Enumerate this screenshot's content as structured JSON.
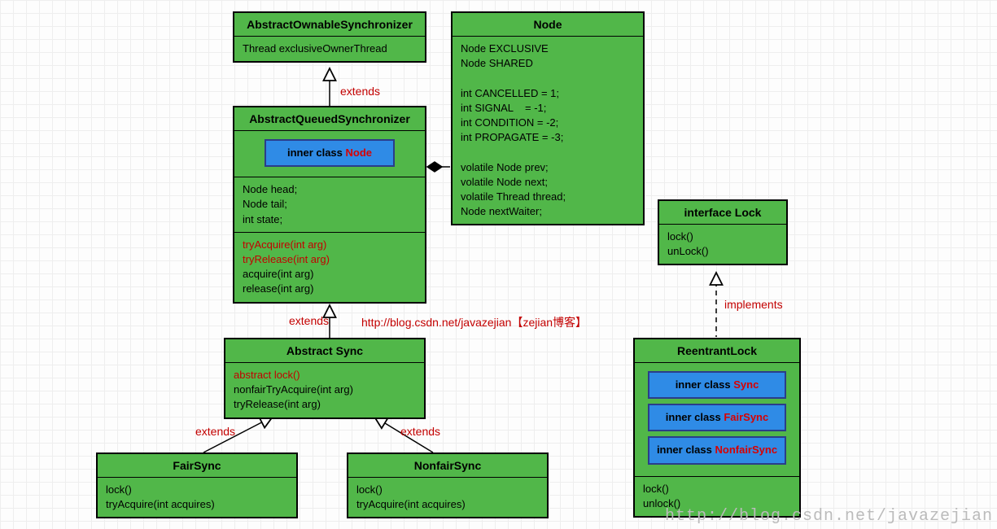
{
  "aos": {
    "title": "AbstractOwnableSynchronizer",
    "field": "Thread exclusiveOwnerThread"
  },
  "aqs": {
    "title": "AbstractQueuedSynchronizer",
    "inner_prefix": "inner class ",
    "inner_name": "Node",
    "fields": "Node head;\nNode tail;\nint state;",
    "methods_red1": "tryAcquire(int arg)",
    "methods_red2": "tryRelease(int arg)",
    "methods_plain": "acquire(int arg)\nrelease(int arg)"
  },
  "node": {
    "title": "Node",
    "body": "Node EXCLUSIVE\nNode SHARED\n\nint CANCELLED = 1;\nint SIGNAL    = -1;\nint CONDITION = -2;\nint PROPAGATE = -3;\n\nvolatile Node prev;\nvolatile Node next;\nvolatile Thread thread;\nNode nextWaiter;"
  },
  "sync": {
    "title": "Abstract Sync",
    "m_red": "abstract lock()",
    "m_plain": "nonfairTryAcquire(int arg)\ntryRelease(int arg)"
  },
  "fair": {
    "title": "FairSync",
    "methods": "lock()\ntryAcquire(int acquires)"
  },
  "nonfair": {
    "title": "NonfairSync",
    "methods": "lock()\ntryAcquire(int acquires)"
  },
  "lock": {
    "title": "interface Lock",
    "methods": "lock()\nunLock()"
  },
  "reentrant": {
    "title": "ReentrantLock",
    "ip": "inner class ",
    "i1": "Sync",
    "i2": "FairSync",
    "i3": "NonfairSync",
    "methods": "lock()\nunlock()"
  },
  "labels": {
    "extends1": "extends",
    "extends2": "extends",
    "extends3": "extends",
    "extends4": "extends",
    "implements": "implements",
    "blog": "http://blog.csdn.net/javazejian【zejian博客】"
  },
  "watermark": "http://blog.csdn.net/javazejian"
}
